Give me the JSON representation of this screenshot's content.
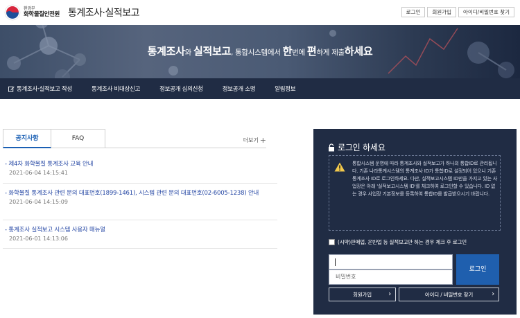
{
  "header": {
    "org_sup": "환경부",
    "org_name": "화학물질안전원",
    "site_title": "통계조사·실적보고",
    "links": [
      "로그인",
      "회원가입",
      "아이디/비밀번호 찾기"
    ]
  },
  "banner": {
    "t1": "통계조사",
    "t2": "와 ",
    "t3": "실적보고",
    "t4": ", 통합시스템에서 ",
    "t5": "한",
    "t6": "번에 ",
    "t7": "편",
    "t8": "하게 제출",
    "t9": "하세요"
  },
  "nav": {
    "items": [
      "통계조사·실적보고 작성",
      "통계조사 비대상신고",
      "정보공개 심의신청",
      "정보공개 소명",
      "알림정보"
    ]
  },
  "tabs": {
    "active": "공지사항",
    "other": "FAQ",
    "more": "더보기"
  },
  "notices": [
    {
      "title": "- 제4차 화학물질 통계조사 교육 안내",
      "date": "2021-06-04 14:15:41"
    },
    {
      "title": "- 화학물질 통계조사 관련 문의 대표번호(1899-1461), 시스템 관련 문의 대표번호(02-6005-1238) 안내",
      "date": "2021-06-04 14:15:09"
    },
    {
      "title": "- 통계조사 실적보고 시스템 사용자 매뉴얼",
      "date": "2021-06-01 14:13:06"
    }
  ],
  "login": {
    "title": "로그인 하세요",
    "info": "통합시스템 운영에 따라 통계조사와 실적보고가 하나의 통합ID로 관리됩니다. 기존 나라통계시스템의 통계조사 ID가 통합ID로 설정되어 있으니 기존 통계조사 ID로 로그인하세요. 다만, 실적보고시스템 ID만을 가지고 있는 사업장은 아래 '실적보고시스템 ID'를 체크하여 로그인할 수 있습니다. ID 없는 경우 사업장 기본정보를 등록하여 통합ID를 발급받으시기 바랍니다.",
    "checkbox_label": "(시약)판매업, 운반업 등 실적보고만 하는 경우 체크 후 로그인",
    "password_placeholder": "비밀번호",
    "login_button": "로그인",
    "signup_button": "회원가입",
    "find_button": "아이디 / 비밀번호 찾기"
  },
  "colors": {
    "nav_bg": "#202c44",
    "accent_blue": "#1f5fae",
    "link_blue": "#2547a4"
  }
}
